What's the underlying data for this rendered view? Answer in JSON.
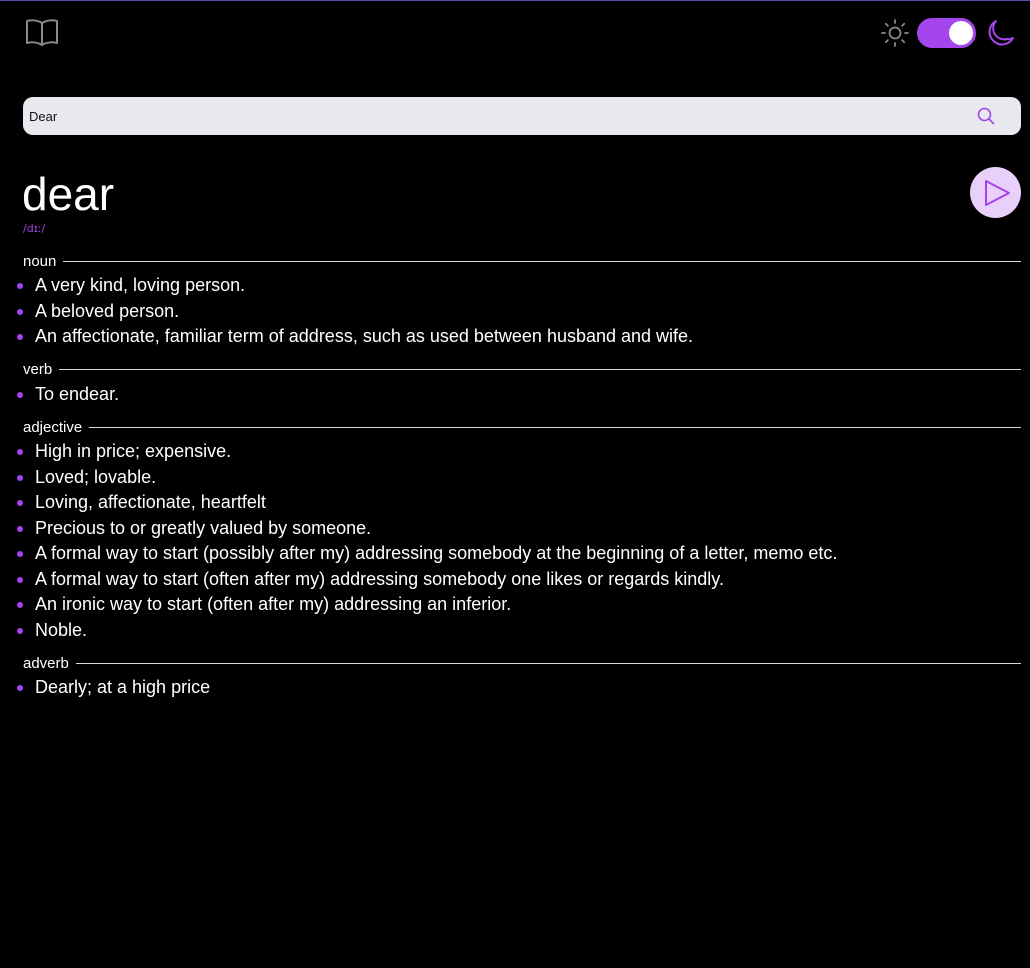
{
  "colors": {
    "accent": "#a445ed",
    "background": "#000000",
    "search_bg": "#e8e8ee",
    "play_bg": "#e9d0fa"
  },
  "header": {
    "logo_icon": "book-open-icon",
    "light_icon": "sun-icon",
    "dark_icon": "moon-icon",
    "theme_toggle_state": "dark"
  },
  "search": {
    "value": "Dear",
    "icon": "search-icon"
  },
  "entry": {
    "word": "dear",
    "phonetic": "/dɪː/",
    "play_icon": "play-icon",
    "meanings": [
      {
        "pos": "noun",
        "definitions": [
          "A very kind, loving person.",
          "A beloved person.",
          "An affectionate, familiar term of address, such as used between husband and wife."
        ]
      },
      {
        "pos": "verb",
        "definitions": [
          "To endear."
        ]
      },
      {
        "pos": "adjective",
        "definitions": [
          "High in price; expensive.",
          "Loved; lovable.",
          "Loving, affectionate, heartfelt",
          "Precious to or greatly valued by someone.",
          "A formal way to start (possibly after my) addressing somebody at the beginning of a letter, memo etc.",
          "A formal way to start (often after my) addressing somebody one likes or regards kindly.",
          "An ironic way to start (often after my) addressing an inferior.",
          "Noble."
        ]
      },
      {
        "pos": "adverb",
        "definitions": [
          "Dearly; at a high price"
        ]
      }
    ]
  }
}
